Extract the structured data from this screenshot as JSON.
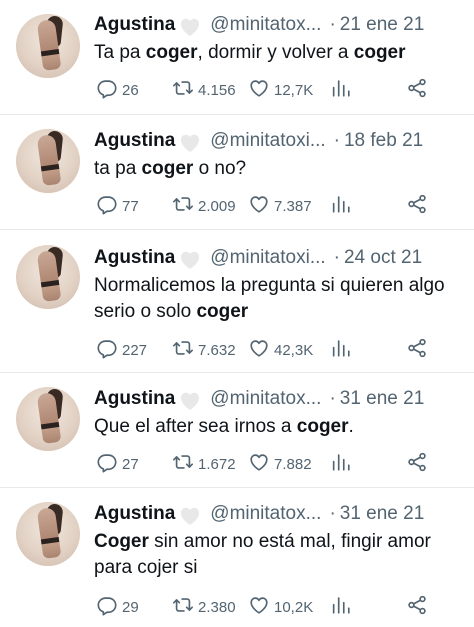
{
  "tweets": [
    {
      "name": "Agustina",
      "handle": "@minitatox...",
      "date": "21 ene 21",
      "segments": [
        {
          "t": "Ta pa ",
          "b": false
        },
        {
          "t": "coger",
          "b": true
        },
        {
          "t": ", dormir y volver a ",
          "b": false
        },
        {
          "t": "coger",
          "b": true
        }
      ],
      "replies": "26",
      "retweets": "4.156",
      "likes": "12,7K"
    },
    {
      "name": "Agustina",
      "handle": "@minitatoxi...",
      "date": "18 feb 21",
      "segments": [
        {
          "t": "ta pa ",
          "b": false
        },
        {
          "t": "coger",
          "b": true
        },
        {
          "t": " o no?",
          "b": false
        }
      ],
      "replies": "77",
      "retweets": "2.009",
      "likes": "7.387"
    },
    {
      "name": "Agustina",
      "handle": "@minitatoxi...",
      "date": "24 oct 21",
      "segments": [
        {
          "t": "Normalicemos la pregunta si quieren algo serio o solo ",
          "b": false
        },
        {
          "t": "coger",
          "b": true
        }
      ],
      "replies": "227",
      "retweets": "7.632",
      "likes": "42,3K"
    },
    {
      "name": "Agustina",
      "handle": "@minitatox...",
      "date": "31 ene 21",
      "segments": [
        {
          "t": "Que el after sea irnos a ",
          "b": false
        },
        {
          "t": "coger",
          "b": true
        },
        {
          "t": ".",
          "b": false
        }
      ],
      "replies": "27",
      "retweets": "1.672",
      "likes": "7.882"
    },
    {
      "name": "Agustina",
      "handle": "@minitatox...",
      "date": "31 ene 21",
      "segments": [
        {
          "t": "Coger",
          "b": true
        },
        {
          "t": " sin amor no está mal, fingir amor para cojer si",
          "b": false
        }
      ],
      "replies": "29",
      "retweets": "2.380",
      "likes": "10,2K"
    }
  ],
  "icons": {
    "reply": "reply-icon",
    "retweet": "retweet-icon",
    "like": "heart-icon",
    "views": "views-icon",
    "share": "share-icon",
    "badge": "white-heart-icon"
  },
  "colors": {
    "text": "#0f1419",
    "muted": "#536471",
    "divider": "#e6e9eb",
    "badge": "#e8e8e8"
  }
}
